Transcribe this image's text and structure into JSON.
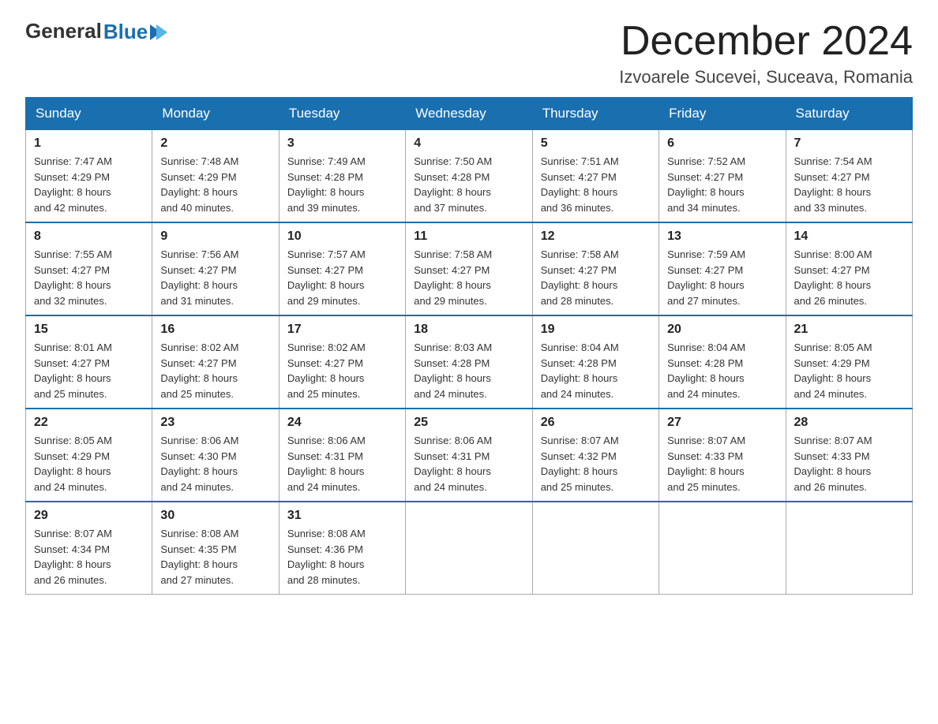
{
  "header": {
    "title": "December 2024",
    "subtitle": "Izvoarele Sucevei, Suceava, Romania",
    "logo_general": "General",
    "logo_blue": "Blue"
  },
  "days_of_week": [
    "Sunday",
    "Monday",
    "Tuesday",
    "Wednesday",
    "Thursday",
    "Friday",
    "Saturday"
  ],
  "weeks": [
    [
      {
        "day": "1",
        "info": "Sunrise: 7:47 AM\nSunset: 4:29 PM\nDaylight: 8 hours\nand 42 minutes."
      },
      {
        "day": "2",
        "info": "Sunrise: 7:48 AM\nSunset: 4:29 PM\nDaylight: 8 hours\nand 40 minutes."
      },
      {
        "day": "3",
        "info": "Sunrise: 7:49 AM\nSunset: 4:28 PM\nDaylight: 8 hours\nand 39 minutes."
      },
      {
        "day": "4",
        "info": "Sunrise: 7:50 AM\nSunset: 4:28 PM\nDaylight: 8 hours\nand 37 minutes."
      },
      {
        "day": "5",
        "info": "Sunrise: 7:51 AM\nSunset: 4:27 PM\nDaylight: 8 hours\nand 36 minutes."
      },
      {
        "day": "6",
        "info": "Sunrise: 7:52 AM\nSunset: 4:27 PM\nDaylight: 8 hours\nand 34 minutes."
      },
      {
        "day": "7",
        "info": "Sunrise: 7:54 AM\nSunset: 4:27 PM\nDaylight: 8 hours\nand 33 minutes."
      }
    ],
    [
      {
        "day": "8",
        "info": "Sunrise: 7:55 AM\nSunset: 4:27 PM\nDaylight: 8 hours\nand 32 minutes."
      },
      {
        "day": "9",
        "info": "Sunrise: 7:56 AM\nSunset: 4:27 PM\nDaylight: 8 hours\nand 31 minutes."
      },
      {
        "day": "10",
        "info": "Sunrise: 7:57 AM\nSunset: 4:27 PM\nDaylight: 8 hours\nand 29 minutes."
      },
      {
        "day": "11",
        "info": "Sunrise: 7:58 AM\nSunset: 4:27 PM\nDaylight: 8 hours\nand 29 minutes."
      },
      {
        "day": "12",
        "info": "Sunrise: 7:58 AM\nSunset: 4:27 PM\nDaylight: 8 hours\nand 28 minutes."
      },
      {
        "day": "13",
        "info": "Sunrise: 7:59 AM\nSunset: 4:27 PM\nDaylight: 8 hours\nand 27 minutes."
      },
      {
        "day": "14",
        "info": "Sunrise: 8:00 AM\nSunset: 4:27 PM\nDaylight: 8 hours\nand 26 minutes."
      }
    ],
    [
      {
        "day": "15",
        "info": "Sunrise: 8:01 AM\nSunset: 4:27 PM\nDaylight: 8 hours\nand 25 minutes."
      },
      {
        "day": "16",
        "info": "Sunrise: 8:02 AM\nSunset: 4:27 PM\nDaylight: 8 hours\nand 25 minutes."
      },
      {
        "day": "17",
        "info": "Sunrise: 8:02 AM\nSunset: 4:27 PM\nDaylight: 8 hours\nand 25 minutes."
      },
      {
        "day": "18",
        "info": "Sunrise: 8:03 AM\nSunset: 4:28 PM\nDaylight: 8 hours\nand 24 minutes."
      },
      {
        "day": "19",
        "info": "Sunrise: 8:04 AM\nSunset: 4:28 PM\nDaylight: 8 hours\nand 24 minutes."
      },
      {
        "day": "20",
        "info": "Sunrise: 8:04 AM\nSunset: 4:28 PM\nDaylight: 8 hours\nand 24 minutes."
      },
      {
        "day": "21",
        "info": "Sunrise: 8:05 AM\nSunset: 4:29 PM\nDaylight: 8 hours\nand 24 minutes."
      }
    ],
    [
      {
        "day": "22",
        "info": "Sunrise: 8:05 AM\nSunset: 4:29 PM\nDaylight: 8 hours\nand 24 minutes."
      },
      {
        "day": "23",
        "info": "Sunrise: 8:06 AM\nSunset: 4:30 PM\nDaylight: 8 hours\nand 24 minutes."
      },
      {
        "day": "24",
        "info": "Sunrise: 8:06 AM\nSunset: 4:31 PM\nDaylight: 8 hours\nand 24 minutes."
      },
      {
        "day": "25",
        "info": "Sunrise: 8:06 AM\nSunset: 4:31 PM\nDaylight: 8 hours\nand 24 minutes."
      },
      {
        "day": "26",
        "info": "Sunrise: 8:07 AM\nSunset: 4:32 PM\nDaylight: 8 hours\nand 25 minutes."
      },
      {
        "day": "27",
        "info": "Sunrise: 8:07 AM\nSunset: 4:33 PM\nDaylight: 8 hours\nand 25 minutes."
      },
      {
        "day": "28",
        "info": "Sunrise: 8:07 AM\nSunset: 4:33 PM\nDaylight: 8 hours\nand 26 minutes."
      }
    ],
    [
      {
        "day": "29",
        "info": "Sunrise: 8:07 AM\nSunset: 4:34 PM\nDaylight: 8 hours\nand 26 minutes."
      },
      {
        "day": "30",
        "info": "Sunrise: 8:08 AM\nSunset: 4:35 PM\nDaylight: 8 hours\nand 27 minutes."
      },
      {
        "day": "31",
        "info": "Sunrise: 8:08 AM\nSunset: 4:36 PM\nDaylight: 8 hours\nand 28 minutes."
      },
      {
        "day": "",
        "info": ""
      },
      {
        "day": "",
        "info": ""
      },
      {
        "day": "",
        "info": ""
      },
      {
        "day": "",
        "info": ""
      }
    ]
  ]
}
